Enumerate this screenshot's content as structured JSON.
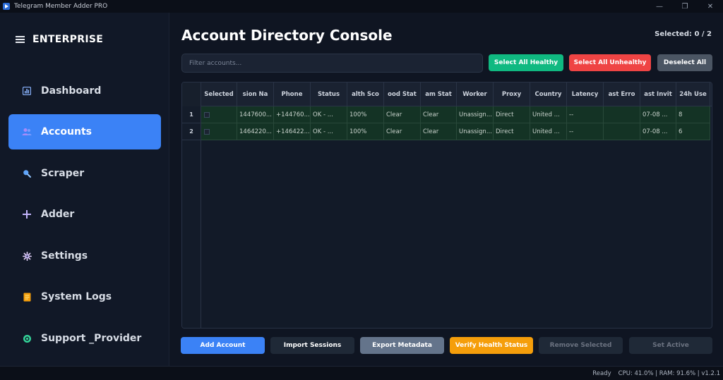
{
  "window": {
    "title": "Telegram Member Adder PRO",
    "controls": [
      "—",
      "❐",
      "✕"
    ]
  },
  "sidebar": {
    "brand": "ENTERPRISE",
    "items": [
      {
        "label": "Dashboard",
        "icon": "dashboard-icon",
        "active": false
      },
      {
        "label": "Accounts",
        "icon": "users-icon",
        "active": true
      },
      {
        "label": "Scraper",
        "icon": "search-icon",
        "active": false
      },
      {
        "label": "Adder",
        "icon": "plus-icon",
        "active": false
      },
      {
        "label": "Settings",
        "icon": "gear-icon",
        "active": false
      },
      {
        "label": "System Logs",
        "icon": "log-icon",
        "active": false
      },
      {
        "label": "Support _Provider",
        "icon": "support-icon",
        "active": false
      }
    ]
  },
  "main": {
    "title": "Account Directory Console",
    "selected_count": "Selected: 0 / 2",
    "filter_placeholder": "Filter accounts...",
    "top_buttons": {
      "select_healthy": "Select All Healthy",
      "select_unhealthy": "Select All Unhealthy",
      "deselect_all": "Deselect All"
    },
    "table": {
      "columns": [
        "Selected",
        "sion Na",
        "Phone",
        "Status",
        "alth Sco",
        "ood Stat",
        "am Stat",
        "Worker",
        "Proxy",
        "Country",
        "Latency",
        "ast Erro",
        "ast Invit",
        "24h Use"
      ],
      "rows": [
        {
          "num": "1",
          "cells": [
            "",
            "1447600...",
            "+144760...",
            "OK - ...",
            "100%",
            "Clear",
            "Clear",
            "Unassign...",
            "Direct",
            "United ...",
            "--",
            "",
            "07-08 ...",
            "8"
          ]
        },
        {
          "num": "2",
          "cells": [
            "",
            "1464220...",
            "+146422...",
            "OK - ...",
            "100%",
            "Clear",
            "Clear",
            "Unassign...",
            "Direct",
            "United ...",
            "--",
            "",
            "07-08 ...",
            "6"
          ]
        }
      ]
    },
    "bottom_buttons": {
      "add_account": "Add Account",
      "import_sessions": "Import Sessions",
      "export_metadata": "Export Metadata",
      "verify_health": "Verify Health Status",
      "remove_selected": "Remove Selected",
      "set_active": "Set Active"
    }
  },
  "status_bar": {
    "state": "Ready",
    "metrics": "CPU: 41.0% | RAM: 91.6% | v1.2.1"
  },
  "colors": {
    "accent": "#3b82f6",
    "healthy": "#10b981",
    "unhealthy": "#ef4444",
    "warning": "#f59e0b",
    "row_ok": "#143325"
  }
}
